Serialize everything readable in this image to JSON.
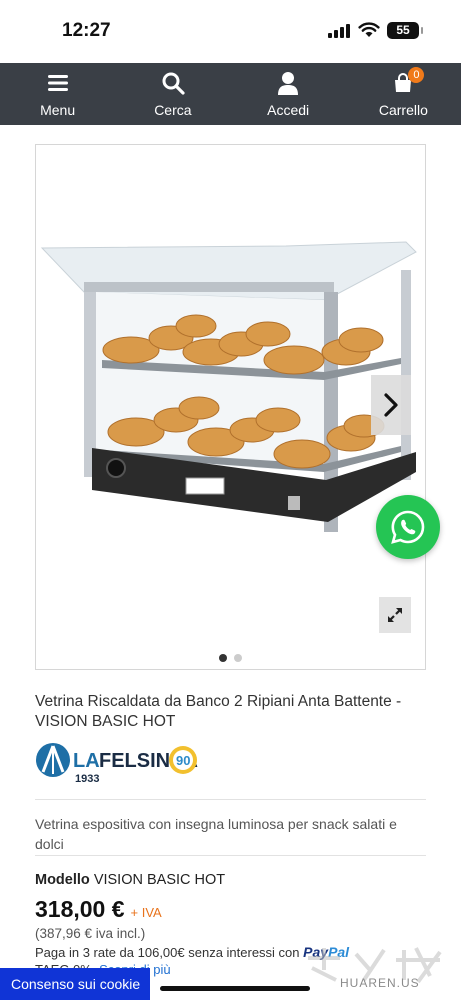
{
  "status_bar": {
    "time": "12:27",
    "battery": "55"
  },
  "navbar": {
    "items": [
      {
        "label": "Menu",
        "icon": "hamburger-icon"
      },
      {
        "label": "Cerca",
        "icon": "search-icon"
      },
      {
        "label": "Accedi",
        "icon": "user-icon"
      },
      {
        "label": "Carrello",
        "icon": "cart-icon"
      }
    ],
    "cart_count": "0",
    "background": "#3a3f46",
    "badge_color": "#f07a1a"
  },
  "gallery": {
    "image": "heated-display-case-with-croissants",
    "slide_count": 2,
    "active_slide": 1
  },
  "product": {
    "title": "Vetrina Riscaldata da Banco 2 Ripiani Anta Battente - VISION BASIC HOT",
    "brand": {
      "name": "LA FELSINEA",
      "year": "1933",
      "anniversary": "90"
    },
    "description": "Vetrina espositiva con insegna luminosa per snack salati e dolci",
    "model_label": "Modello",
    "model_value": "VISION BASIC HOT",
    "price": "318,00 €",
    "price_suffix": "+ IVA",
    "price_incl": "(387,96 € iva incl.)",
    "installments": "Paga in 3 rate da 106,00€ senza interessi con",
    "paypal_part1": "Pay",
    "paypal_part2": "Pal",
    "taeg": "TAEG 0%.",
    "learn_more": "Scopri di più"
  },
  "cookie_bar": {
    "label": "Consenso sui cookie",
    "color": "#1034d6"
  },
  "whatsapp": {
    "icon": "whatsapp-icon",
    "color": "#25c554"
  },
  "watermark": {
    "text": "HUAREN.US"
  }
}
